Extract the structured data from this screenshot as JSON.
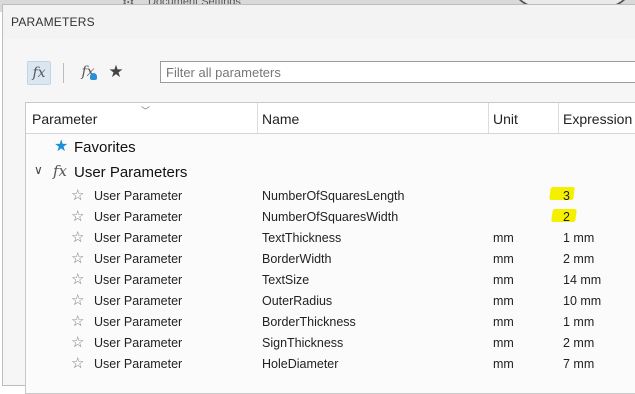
{
  "background": {
    "doc_settings_label": "Document Settings"
  },
  "dialog": {
    "title": "PARAMETERS",
    "toolbar": {
      "fx_label": "fx",
      "fx_user_label": "fx",
      "favorite_icon": "star-icon",
      "filter_placeholder": "Filter all parameters"
    },
    "columns": [
      "Parameter",
      "Name",
      "Unit",
      "Expression"
    ],
    "groups": {
      "favorites": "Favorites",
      "user_parameters": "User Parameters"
    },
    "rows": [
      {
        "type": "User Parameter",
        "name": "NumberOfSquaresLength",
        "unit": "",
        "expression": "3"
      },
      {
        "type": "User Parameter",
        "name": "NumberOfSquaresWidth",
        "unit": "",
        "expression": "2"
      },
      {
        "type": "User Parameter",
        "name": "TextThickness",
        "unit": "mm",
        "expression": "1 mm"
      },
      {
        "type": "User Parameter",
        "name": "BorderWidth",
        "unit": "mm",
        "expression": "2 mm"
      },
      {
        "type": "User Parameter",
        "name": "TextSize",
        "unit": "mm",
        "expression": "14 mm"
      },
      {
        "type": "User Parameter",
        "name": "OuterRadius",
        "unit": "mm",
        "expression": "10 mm"
      },
      {
        "type": "User Parameter",
        "name": "BorderThickness",
        "unit": "mm",
        "expression": "1 mm"
      },
      {
        "type": "User Parameter",
        "name": "SignThickness",
        "unit": "mm",
        "expression": "2 mm"
      },
      {
        "type": "User Parameter",
        "name": "HoleDiameter",
        "unit": "mm",
        "expression": "7 mm"
      }
    ],
    "colors": {
      "accent": "#1a8fd8",
      "highlight": "#f4f000"
    }
  }
}
